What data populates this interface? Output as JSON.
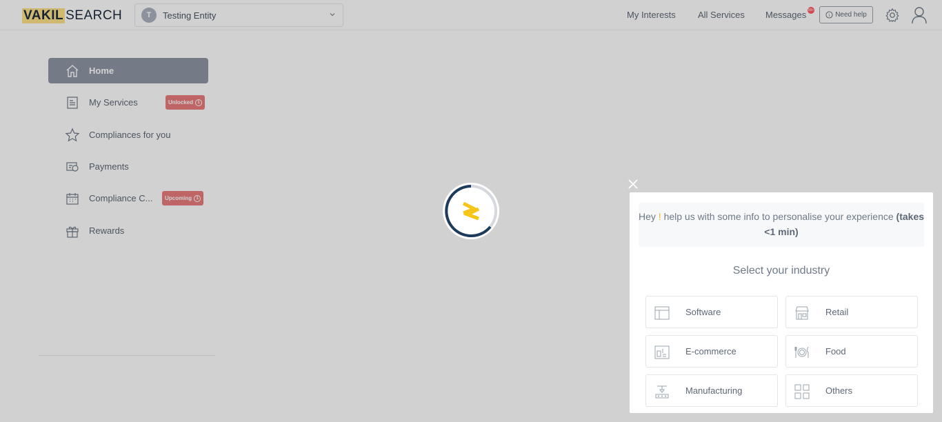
{
  "header": {
    "logo_part1": "VAKIL",
    "logo_part2": "SEARCH",
    "entity_initial": "T",
    "entity_name": "Testing Entity",
    "nav": [
      "My Interests",
      "All Services",
      "Messages"
    ],
    "messages_badge": "99+",
    "need_help": "Need help"
  },
  "sidebar": {
    "items": [
      {
        "label": "Home",
        "icon": "home-icon",
        "active": true
      },
      {
        "label": "My Services",
        "icon": "services-list-icon",
        "badge": "Unlocked",
        "badge_count": "1"
      },
      {
        "label": "Compliances for you",
        "icon": "star-icon"
      },
      {
        "label": "Payments",
        "icon": "payments-icon"
      },
      {
        "label": "Compliance C...",
        "icon": "calendar-icon",
        "badge": "Upcoming",
        "badge_count": "1"
      },
      {
        "label": "Rewards",
        "icon": "gift-icon"
      }
    ]
  },
  "modal": {
    "intro_pre": "Hey ",
    "intro_excl": "!",
    "intro_mid": " help us with some info to personalise your experience ",
    "intro_bold": "(takes <1 min)",
    "title": "Select your industry",
    "industries": [
      {
        "label": "Software",
        "icon": "software-icon"
      },
      {
        "label": "Retail",
        "icon": "retail-store-icon"
      },
      {
        "label": "E-commerce",
        "icon": "ecommerce-icon"
      },
      {
        "label": "Food",
        "icon": "food-plate-icon"
      },
      {
        "label": "Manufacturing",
        "icon": "manufacturing-icon"
      },
      {
        "label": "Others",
        "icon": "grid-icon"
      }
    ]
  },
  "colors": {
    "accent_yellow": "#f5c518",
    "loader_navy": "#1f3b5c",
    "badge_red": "#e97c7c"
  }
}
